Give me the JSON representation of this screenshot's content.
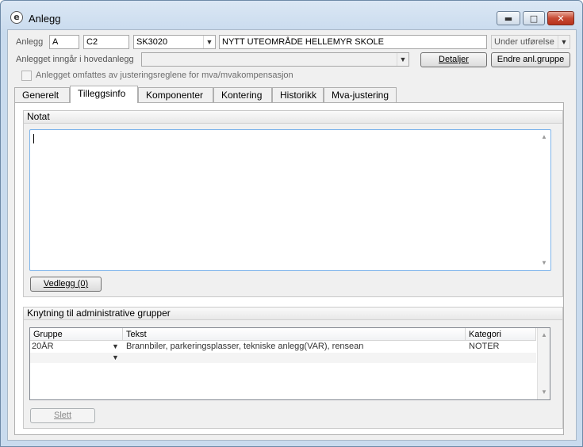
{
  "window": {
    "title": "Anlegg"
  },
  "header": {
    "anlegg_label": "Anlegg",
    "field_a": "A",
    "field_c2": "C2",
    "sk_value": "SK3020",
    "name_value": "NYTT UTEOMRÅDE HELLEMYR SKOLE",
    "status_value": "Under utførelse",
    "hovedanlegg_label": "Anlegget inngår i hovedanlegg",
    "hovedanlegg_value": "",
    "detaljer_button": "Detaljer",
    "endre_button": "Endre anl.gruppe",
    "justering_checkbox_label": "Anlegget omfattes av justeringsreglene for mva/mvakompensasjon",
    "justering_checked": false
  },
  "tabs": [
    {
      "label": "Generelt",
      "active": false
    },
    {
      "label": "Tilleggsinfo",
      "active": true
    },
    {
      "label": "Komponenter",
      "active": false
    },
    {
      "label": "Kontering",
      "active": false
    },
    {
      "label": "Historikk",
      "active": false
    },
    {
      "label": "Mva-justering",
      "active": false
    }
  ],
  "notat": {
    "heading": "Notat",
    "text": "",
    "vedlegg_button": "Vedlegg (0)"
  },
  "grupper": {
    "heading": "Knytning til administrative grupper",
    "columns": [
      "Gruppe",
      "Tekst",
      "Kategori"
    ],
    "rows": [
      {
        "gruppe": "20ÅR",
        "tekst": "Brannbiler, parkeringsplasser, tekniske anlegg(VAR), rensean",
        "kategori": "NOTER"
      },
      {
        "gruppe": "",
        "tekst": "",
        "kategori": ""
      }
    ],
    "slett_button": "Slett"
  }
}
